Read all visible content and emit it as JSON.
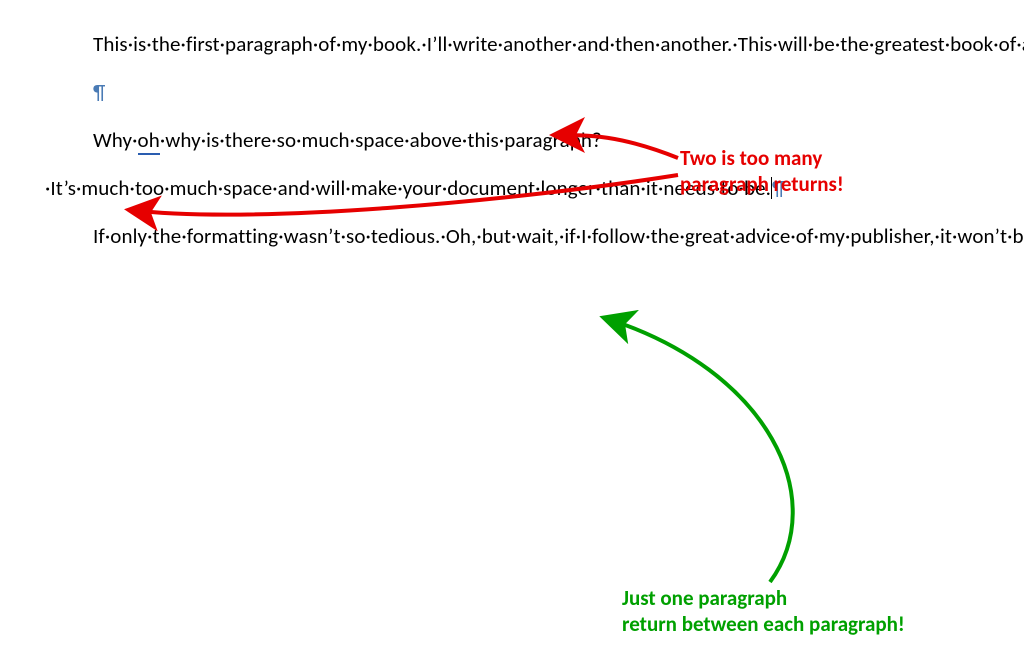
{
  "document": {
    "paragraphs": {
      "p1": "This·is·the·first·paragraph·of·my·book.·I’ll·write·another·and·then·another.·This·will·be·the·greatest·book·of·all·time,·I’m·sure.·It·will·be·greeted·by·thunderous·applause,·and·it·will·change·the·lives·of·students·and·teachers·everywhere.",
      "blank": "",
      "p2_before": "Why·",
      "p2_squiggle": "oh",
      "p2_after": "·why·is·there·so·much·space·above·this·paragraph?·It’s·much·too·much·space·and·will·make·your·document·longer·than·it·needs·to·be.",
      "p3": "If·only·the·formatting·wasn’t·so·tedious.·Oh,·but·wait,·if·I·follow·the·great·advice·of·my·publisher,·it·won’t·be·so·bad.·And·my·copyeditor·will·think·I’m·the·greatest·author·of·all·time·and·that·my·book·is·the·greatest·book·of·all·time.·I’m·sure·this·will·happen.·"
    },
    "marks": {
      "pilcrow": "¶"
    }
  },
  "annotations": {
    "red_label_line1": "Two is too many",
    "red_label_line2": "paragraph returns!",
    "green_label_line1": "Just one paragraph",
    "green_label_line2": "return between each paragraph!",
    "colors": {
      "red": "#e60000",
      "green": "#00a000"
    }
  }
}
